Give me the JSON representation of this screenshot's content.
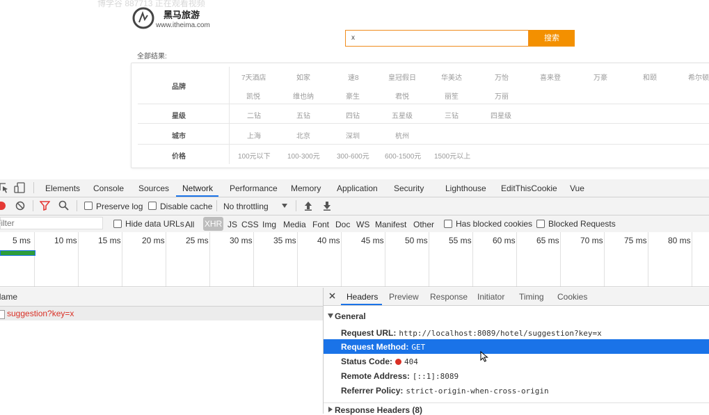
{
  "page": {
    "watermark": "博学谷 887713 正在观看视频",
    "brand": {
      "name": "黑马旅游",
      "url": "www.itheima.com"
    },
    "search": {
      "value": "x",
      "button": "搜索"
    },
    "all_results_label": "全部结果:",
    "filters": [
      {
        "label": "品牌",
        "lines": [
          [
            "7天酒店",
            "如家",
            "速8",
            "皇冠假日",
            "华美达",
            "万怡",
            "喜来登",
            "万豪",
            "和颐",
            "希尔顿"
          ],
          [
            "凯悦",
            "维也纳",
            "豪生",
            "君悦",
            "丽笙",
            "万丽"
          ]
        ]
      },
      {
        "label": "星级",
        "lines": [
          [
            "二钻",
            "五钻",
            "四钻",
            "五星级",
            "三钻",
            "四星级"
          ]
        ]
      },
      {
        "label": "城市",
        "lines": [
          [
            "上海",
            "北京",
            "深圳",
            "杭州"
          ]
        ]
      },
      {
        "label": "价格",
        "lines": [
          [
            "100元以下",
            "100-300元",
            "300-600元",
            "600-1500元",
            "1500元以上"
          ]
        ]
      }
    ]
  },
  "devtools": {
    "main_tabs": [
      "Elements",
      "Console",
      "Sources",
      "Network",
      "Performance",
      "Memory",
      "Application",
      "Security",
      "Lighthouse",
      "EditThisCookie",
      "Vue"
    ],
    "active_tab": "Network",
    "toolbar": {
      "preserve_log": "Preserve log",
      "disable_cache": "Disable cache",
      "throttling": "No throttling"
    },
    "filter_bar": {
      "filter_placeholder": "Filter",
      "hide_data_urls": "Hide data URLs",
      "types": [
        "All",
        "XHR",
        "JS",
        "CSS",
        "Img",
        "Media",
        "Font",
        "Doc",
        "WS",
        "Manifest",
        "Other"
      ],
      "active_type": "XHR",
      "has_blocked_cookies": "Has blocked cookies",
      "blocked_requests": "Blocked Requests"
    },
    "timeline_ticks": [
      "5 ms",
      "10 ms",
      "15 ms",
      "20 ms",
      "25 ms",
      "30 ms",
      "35 ms",
      "40 ms",
      "45 ms",
      "50 ms",
      "55 ms",
      "60 ms",
      "65 ms",
      "70 ms",
      "75 ms",
      "80 ms"
    ],
    "request_list": {
      "header": "Name",
      "rows": [
        {
          "name": "suggestion?key=x"
        }
      ]
    },
    "detail": {
      "tabs": [
        "Headers",
        "Preview",
        "Response",
        "Initiator",
        "Timing",
        "Cookies"
      ],
      "active_tab": "Headers",
      "general_title": "General",
      "general": [
        {
          "key": "Request URL:",
          "value": "http://localhost:8089/hotel/suggestion?key=x"
        },
        {
          "key": "Request Method:",
          "value": "GET"
        },
        {
          "key": "Status Code:",
          "value": "404"
        },
        {
          "key": "Remote Address:",
          "value": "[::1]:8089"
        },
        {
          "key": "Referrer Policy:",
          "value": "strict-origin-when-cross-origin"
        }
      ],
      "response_headers_title": "Response Headers (8)"
    }
  }
}
